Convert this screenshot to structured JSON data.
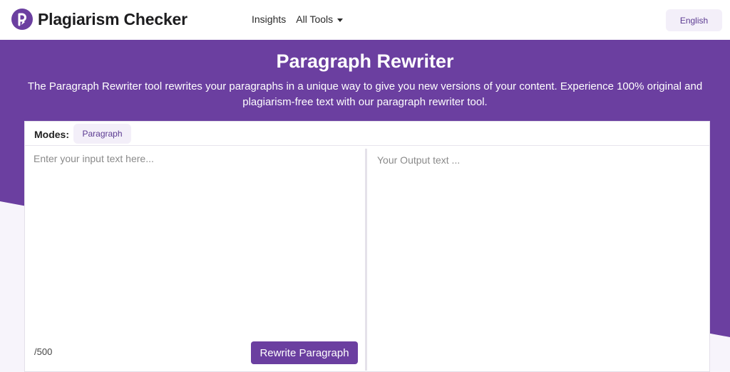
{
  "brand": {
    "name": "Plagiarism Checker",
    "logo_icon": "logo-p-icon"
  },
  "nav": {
    "items": [
      {
        "label": "Insights"
      },
      {
        "label": "All Tools",
        "has_dropdown": true
      }
    ],
    "language": "English"
  },
  "hero": {
    "title": "Paragraph Rewriter",
    "description": "The Paragraph Rewriter tool rewrites your paragraphs in a unique way to give you new versions of your content. Experience 100% original and plagiarism-free text with our paragraph rewriter tool."
  },
  "tool": {
    "modes_label": "Modes:",
    "active_mode": "Paragraph",
    "input_placeholder": "Enter your input text here...",
    "input_value": "",
    "output_placeholder": "Your Output text ...",
    "char_count": "/500",
    "submit_label": "Rewrite Paragraph"
  },
  "colors": {
    "primary": "#6b3fa0",
    "chip_bg": "#f3eff9",
    "page_bg": "#f7f4fb"
  }
}
